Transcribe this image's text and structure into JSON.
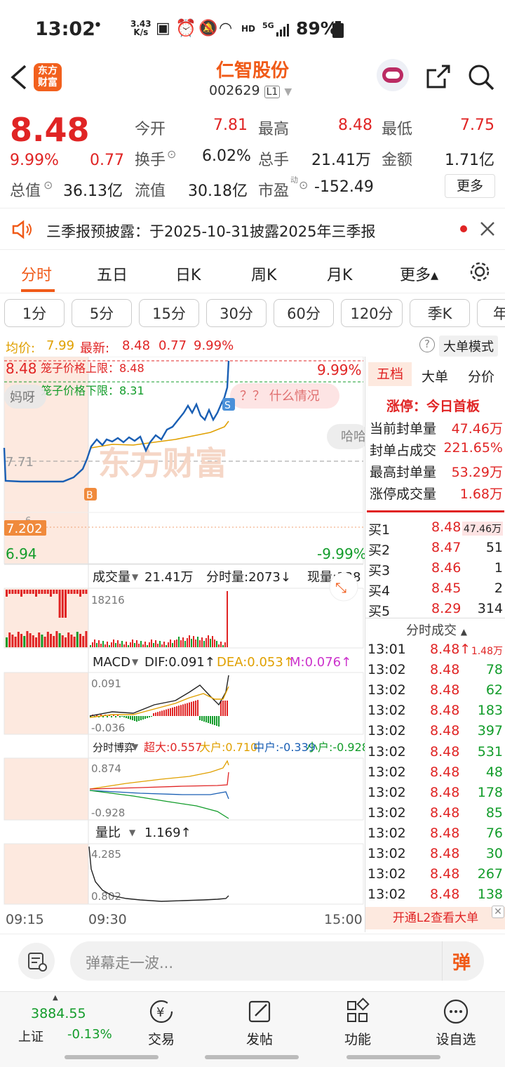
{
  "status": {
    "time": "13:02",
    "speed_top": "3.43",
    "speed_bottom": "K/s",
    "battery": "89%",
    "hd": "HD",
    "net": "5G"
  },
  "header": {
    "app_logo_line1": "东方",
    "app_logo_line2": "财富",
    "stock_name": "仁智股份",
    "stock_code": "002629",
    "level": "L1"
  },
  "quote": {
    "price": "8.48",
    "pct": "9.99%",
    "change": "0.77",
    "open_label": "今开",
    "open": "7.81",
    "high_label": "最高",
    "high": "8.48",
    "low_label": "最低",
    "low": "7.75",
    "turnover_label": "换手",
    "turnover": "6.02%",
    "volume_label": "总手",
    "volume": "21.41万",
    "amount_label": "金额",
    "amount": "1.71亿",
    "mktcap_label": "总值",
    "mktcap": "36.13亿",
    "float_label": "流值",
    "float": "30.18亿",
    "pe_label": "市盈",
    "pe_sup": "动",
    "pe": "-152.49",
    "more": "更多"
  },
  "notice": {
    "text": "三季报预披露：于2025-10-31披露2025年三季报"
  },
  "tabs": [
    "分时",
    "五日",
    "日K",
    "周K",
    "月K",
    "更多▴"
  ],
  "period_tabs": [
    "1分",
    "5分",
    "15分",
    "30分",
    "60分",
    "120分",
    "季K",
    "年"
  ],
  "info": {
    "avg_label": "均价:",
    "avg": "7.99",
    "latest_label": "最新:",
    "latest": "8.48",
    "chg": "0.77",
    "pct": "9.99%",
    "mode": "大单模式"
  },
  "chart": {
    "upper_limit_price": "8.48",
    "upper_limit_text": "笼子价格上限：8.48",
    "lower_limit_text": "笼子价格下限：8.31",
    "pct_top": "9.99%",
    "pct_bottom": "-9.99%",
    "mid_price": "7.71",
    "marker_price": "7.202",
    "low_price": "6.94",
    "small_six": "6",
    "danmu1": "妈呀",
    "danmu2": "？？ 什么情况",
    "danmu3": "哈哈",
    "watermark": "东方财富",
    "buy_marker": "B",
    "sell_marker": "S",
    "vol_label": "成交量",
    "vol_total": "21.41万",
    "vol_tick_label": "分时量:2073↓",
    "vol_now_label": "现量:138",
    "vol_max": "18216",
    "macd_label": "MACD",
    "dif": "DIF:0.091↑",
    "dea": "DEA:0.053↑",
    "m": "M:0.076↑",
    "macd_top": "0.091",
    "macd_bottom": "-0.036",
    "game_label": "分时博弈",
    "super_big": "超大:0.557",
    "big": "大户:0.710",
    "mid": "中户:-0.339",
    "small": "小户:-0.928",
    "game_top": "0.874",
    "game_bottom": "-0.928",
    "ratio_label": "量比",
    "ratio": "1.169↑",
    "ratio_top": "4.285",
    "ratio_bottom": "0.802",
    "time_start": "09:15",
    "time_open": "09:30",
    "time_end": "15:00"
  },
  "side": {
    "tab_five": "五档",
    "tab_big": "大单",
    "tab_price": "分价",
    "limit_title": "涨停：今日首板",
    "seal_label": "当前封单量",
    "seal": "47.46万",
    "seal_ratio_label": "封单占成交",
    "seal_ratio": "221.65%",
    "max_seal_label": "最高封单量",
    "max_seal": "53.29万",
    "limit_vol_label": "涨停成交量",
    "limit_vol": "1.68万",
    "bids": [
      {
        "label": "买1",
        "price": "8.48",
        "vol": "47.46万"
      },
      {
        "label": "买2",
        "price": "8.47",
        "vol": "51"
      },
      {
        "label": "买3",
        "price": "8.46",
        "vol": "1"
      },
      {
        "label": "买4",
        "price": "8.45",
        "vol": "2"
      },
      {
        "label": "买5",
        "price": "8.29",
        "vol": "314"
      }
    ],
    "ticks_title": "分时成交",
    "ticks": [
      {
        "t": "13:01",
        "p": "8.48↑",
        "v": "1.48万",
        "c": "red"
      },
      {
        "t": "13:02",
        "p": "8.48",
        "v": "78",
        "c": "green"
      },
      {
        "t": "13:02",
        "p": "8.48",
        "v": "62",
        "c": "green"
      },
      {
        "t": "13:02",
        "p": "8.48",
        "v": "183",
        "c": "green"
      },
      {
        "t": "13:02",
        "p": "8.48",
        "v": "397",
        "c": "green"
      },
      {
        "t": "13:02",
        "p": "8.48",
        "v": "531",
        "c": "green"
      },
      {
        "t": "13:02",
        "p": "8.48",
        "v": "48",
        "c": "green"
      },
      {
        "t": "13:02",
        "p": "8.48",
        "v": "178",
        "c": "green"
      },
      {
        "t": "13:02",
        "p": "8.48",
        "v": "85",
        "c": "green"
      },
      {
        "t": "13:02",
        "p": "8.48",
        "v": "76",
        "c": "green"
      },
      {
        "t": "13:02",
        "p": "8.48",
        "v": "30",
        "c": "green"
      },
      {
        "t": "13:02",
        "p": "8.48",
        "v": "267",
        "c": "green"
      },
      {
        "t": "13:02",
        "p": "8.48",
        "v": "138",
        "c": "green"
      }
    ],
    "l2_banner": "开通L2查看大单"
  },
  "danmu_input": {
    "placeholder": "弹幕走一波...",
    "send": "弹"
  },
  "nav": {
    "index_value": "3884.55",
    "index_name": "上证",
    "index_pct": "-0.13%",
    "trade": "交易",
    "post": "发帖",
    "func": "功能",
    "watch": "设自选"
  }
}
